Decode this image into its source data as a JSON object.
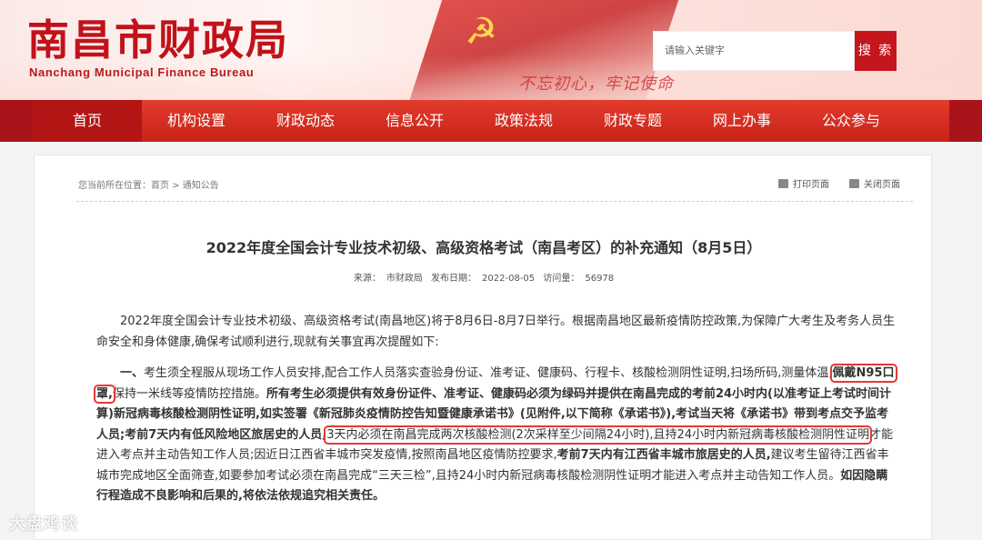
{
  "header": {
    "logo_cn": "南昌市财政局",
    "logo_en": "Nanchang Municipal Finance Bureau",
    "slogan": "不忘初心，牢记使命",
    "search_placeholder": "请输入关键字",
    "search_button": "搜 索"
  },
  "nav": {
    "items": [
      "首页",
      "机构设置",
      "财政动态",
      "信息公开",
      "政策法规",
      "财政专题",
      "网上办事",
      "公众参与"
    ],
    "active_index": 0
  },
  "page": {
    "breadcrumb": "您当前所在位置：首页 > 通知公告",
    "print_label": "打印页面",
    "close_label": "关闭页面",
    "title": "2022年度全国会计专业技术初级、高级资格考试（南昌考区）的补充通知（8月5日）",
    "meta": {
      "source_label": "来源：",
      "source": "市财政局",
      "date_label": "发布日期：",
      "date": "2022-08-05",
      "views_label": "访问量：",
      "views": "56978"
    },
    "para1": "2022年度全国会计专业技术初级、高级资格考试(南昌地区)将于8月6日-8月7日举行。根据南昌地区最新疫情防控政策,为保障广大考生及考务人员生命安全和身体健康,确保考试顺利进行,现就有关事宜再次提醒如下:",
    "para2": {
      "s1": "一、",
      "s2": "考生须全程服从现场工作人员安排,配合工作人员落实查验身份证、准考证、健康码、行程卡、核酸检测阴性证明,扫场所码,测量体温,",
      "s3": "佩戴N95口罩,",
      "s4": "保持一米线等疫情防控措施。",
      "s5": "所有考生必须提供有效身份证件、准考证、健康码必须为绿码并提供在南昌完成的考前24小时内(以准考证上考试时间计算)新冠病毒核酸检测阴性证明,如实签署《新冠肺炎疫情防控告知暨健康承诺书》(见附件,以下简称《承诺书》),考试当天将《承诺书》带到考点交予监考人员;考前7天内有低风险地区旅居史的人员,",
      "s6": "3天内必须在南昌完成两次核酸检测(2次采样至少间隔24小时),且持24小时内新冠病毒核酸检测阴性证明",
      "s7": "才能进入考点并主动告知工作人员;因近日江西省丰城市突发疫情,按照南昌地区疫情防控要求,",
      "s8": "考前7天内有江西省丰城市旅居史的人员,",
      "s9": "建议考生留待江西省丰城市完成地区全面筛查,如要参加考试必须在南昌完成“三天三检”,且持24小时内新冠病毒核酸检测阴性证明才能进入考点并主动告知工作人员。",
      "s10": "如因隐瞒行程造成不良影响和后果的,将依法依规追究相关责任。"
    }
  },
  "watermark": "大盘鸡谈"
}
